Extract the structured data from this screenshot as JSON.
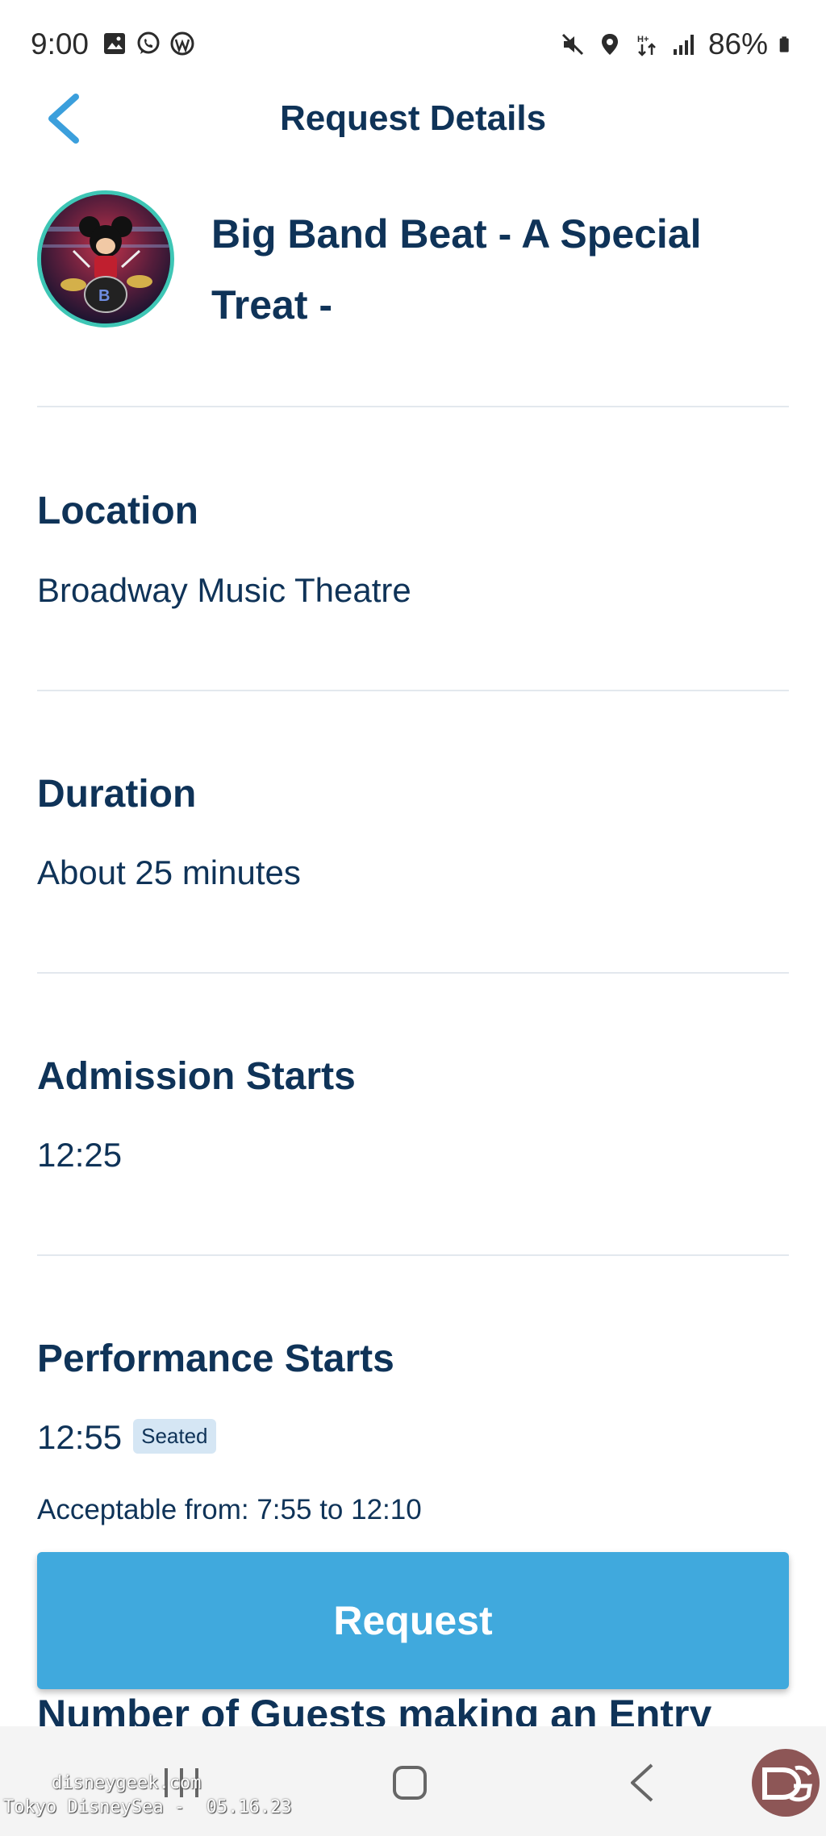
{
  "status_bar": {
    "time": "9:00",
    "battery": "86%",
    "left_icons": [
      "gallery-icon",
      "whatsapp-icon",
      "wordpress-icon"
    ],
    "right_icons": [
      "mute-icon",
      "location-icon",
      "data-icon",
      "signal-icon",
      "battery-icon"
    ]
  },
  "header": {
    "title": "Request Details",
    "back_icon": "chevron-left-icon"
  },
  "event": {
    "title": "Big Band Beat - A Special Treat -"
  },
  "sections": {
    "location": {
      "heading": "Location",
      "value": "Broadway Music Theatre"
    },
    "duration": {
      "heading": "Duration",
      "value": "About 25 minutes"
    },
    "admission": {
      "heading": "Admission Starts",
      "value": "12:25"
    },
    "performance": {
      "heading": "Performance Starts",
      "value": "12:55",
      "badge": "Seated",
      "acceptable": "Acceptable from: 7:55 to 12:10"
    },
    "guests": {
      "heading": "Number of Guests making an Entry"
    }
  },
  "actions": {
    "request_label": "Request"
  },
  "colors": {
    "primary_text": "#0f3358",
    "accent": "#40a9dd",
    "avatar_ring": "#3ec6b5",
    "badge_bg": "#d5e6f4"
  },
  "watermark": {
    "line1": "disneygeek.com",
    "line2": "Tokyo DisneySea -  05.16.23"
  }
}
